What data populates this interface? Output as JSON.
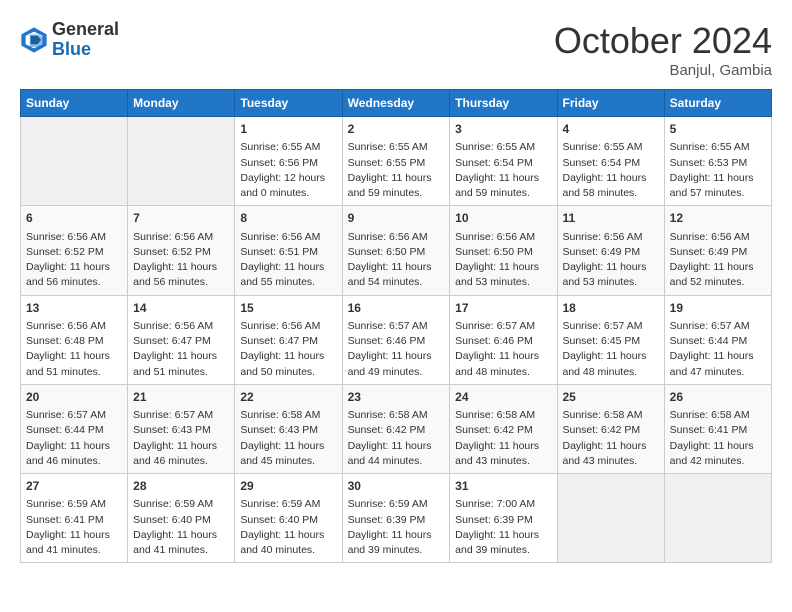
{
  "header": {
    "logo_general": "General",
    "logo_blue": "Blue",
    "month": "October 2024",
    "location": "Banjul, Gambia"
  },
  "days_of_week": [
    "Sunday",
    "Monday",
    "Tuesday",
    "Wednesday",
    "Thursday",
    "Friday",
    "Saturday"
  ],
  "weeks": [
    [
      {
        "day": "",
        "info": ""
      },
      {
        "day": "",
        "info": ""
      },
      {
        "day": "1",
        "info": "Sunrise: 6:55 AM\nSunset: 6:56 PM\nDaylight: 12 hours\nand 0 minutes."
      },
      {
        "day": "2",
        "info": "Sunrise: 6:55 AM\nSunset: 6:55 PM\nDaylight: 11 hours\nand 59 minutes."
      },
      {
        "day": "3",
        "info": "Sunrise: 6:55 AM\nSunset: 6:54 PM\nDaylight: 11 hours\nand 59 minutes."
      },
      {
        "day": "4",
        "info": "Sunrise: 6:55 AM\nSunset: 6:54 PM\nDaylight: 11 hours\nand 58 minutes."
      },
      {
        "day": "5",
        "info": "Sunrise: 6:55 AM\nSunset: 6:53 PM\nDaylight: 11 hours\nand 57 minutes."
      }
    ],
    [
      {
        "day": "6",
        "info": "Sunrise: 6:56 AM\nSunset: 6:52 PM\nDaylight: 11 hours\nand 56 minutes."
      },
      {
        "day": "7",
        "info": "Sunrise: 6:56 AM\nSunset: 6:52 PM\nDaylight: 11 hours\nand 56 minutes."
      },
      {
        "day": "8",
        "info": "Sunrise: 6:56 AM\nSunset: 6:51 PM\nDaylight: 11 hours\nand 55 minutes."
      },
      {
        "day": "9",
        "info": "Sunrise: 6:56 AM\nSunset: 6:50 PM\nDaylight: 11 hours\nand 54 minutes."
      },
      {
        "day": "10",
        "info": "Sunrise: 6:56 AM\nSunset: 6:50 PM\nDaylight: 11 hours\nand 53 minutes."
      },
      {
        "day": "11",
        "info": "Sunrise: 6:56 AM\nSunset: 6:49 PM\nDaylight: 11 hours\nand 53 minutes."
      },
      {
        "day": "12",
        "info": "Sunrise: 6:56 AM\nSunset: 6:49 PM\nDaylight: 11 hours\nand 52 minutes."
      }
    ],
    [
      {
        "day": "13",
        "info": "Sunrise: 6:56 AM\nSunset: 6:48 PM\nDaylight: 11 hours\nand 51 minutes."
      },
      {
        "day": "14",
        "info": "Sunrise: 6:56 AM\nSunset: 6:47 PM\nDaylight: 11 hours\nand 51 minutes."
      },
      {
        "day": "15",
        "info": "Sunrise: 6:56 AM\nSunset: 6:47 PM\nDaylight: 11 hours\nand 50 minutes."
      },
      {
        "day": "16",
        "info": "Sunrise: 6:57 AM\nSunset: 6:46 PM\nDaylight: 11 hours\nand 49 minutes."
      },
      {
        "day": "17",
        "info": "Sunrise: 6:57 AM\nSunset: 6:46 PM\nDaylight: 11 hours\nand 48 minutes."
      },
      {
        "day": "18",
        "info": "Sunrise: 6:57 AM\nSunset: 6:45 PM\nDaylight: 11 hours\nand 48 minutes."
      },
      {
        "day": "19",
        "info": "Sunrise: 6:57 AM\nSunset: 6:44 PM\nDaylight: 11 hours\nand 47 minutes."
      }
    ],
    [
      {
        "day": "20",
        "info": "Sunrise: 6:57 AM\nSunset: 6:44 PM\nDaylight: 11 hours\nand 46 minutes."
      },
      {
        "day": "21",
        "info": "Sunrise: 6:57 AM\nSunset: 6:43 PM\nDaylight: 11 hours\nand 46 minutes."
      },
      {
        "day": "22",
        "info": "Sunrise: 6:58 AM\nSunset: 6:43 PM\nDaylight: 11 hours\nand 45 minutes."
      },
      {
        "day": "23",
        "info": "Sunrise: 6:58 AM\nSunset: 6:42 PM\nDaylight: 11 hours\nand 44 minutes."
      },
      {
        "day": "24",
        "info": "Sunrise: 6:58 AM\nSunset: 6:42 PM\nDaylight: 11 hours\nand 43 minutes."
      },
      {
        "day": "25",
        "info": "Sunrise: 6:58 AM\nSunset: 6:42 PM\nDaylight: 11 hours\nand 43 minutes."
      },
      {
        "day": "26",
        "info": "Sunrise: 6:58 AM\nSunset: 6:41 PM\nDaylight: 11 hours\nand 42 minutes."
      }
    ],
    [
      {
        "day": "27",
        "info": "Sunrise: 6:59 AM\nSunset: 6:41 PM\nDaylight: 11 hours\nand 41 minutes."
      },
      {
        "day": "28",
        "info": "Sunrise: 6:59 AM\nSunset: 6:40 PM\nDaylight: 11 hours\nand 41 minutes."
      },
      {
        "day": "29",
        "info": "Sunrise: 6:59 AM\nSunset: 6:40 PM\nDaylight: 11 hours\nand 40 minutes."
      },
      {
        "day": "30",
        "info": "Sunrise: 6:59 AM\nSunset: 6:39 PM\nDaylight: 11 hours\nand 39 minutes."
      },
      {
        "day": "31",
        "info": "Sunrise: 7:00 AM\nSunset: 6:39 PM\nDaylight: 11 hours\nand 39 minutes."
      },
      {
        "day": "",
        "info": ""
      },
      {
        "day": "",
        "info": ""
      }
    ]
  ]
}
